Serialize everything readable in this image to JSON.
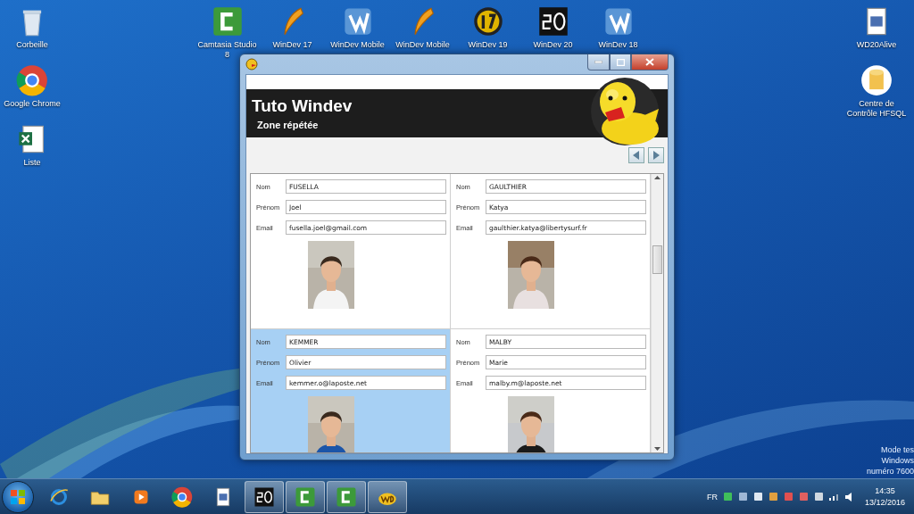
{
  "desktop": {
    "left_icons": [
      {
        "label": "Corbeille",
        "kind": "recycle-bin"
      },
      {
        "label": "Google Chrome",
        "kind": "chrome"
      },
      {
        "label": "Liste",
        "kind": "spreadsheet"
      }
    ],
    "top_icons": [
      {
        "label": "Camtasia Studio 8",
        "kind": "camtasia"
      },
      {
        "label": "WinDev 17",
        "kind": "windev"
      },
      {
        "label": "WinDev Mobile",
        "kind": "windev-mobile"
      },
      {
        "label": "WinDev Mobile",
        "kind": "windev"
      },
      {
        "label": "WinDev 19",
        "kind": "badge-19"
      },
      {
        "label": "WinDev 20",
        "kind": "badge-20"
      },
      {
        "label": "WinDev 18",
        "kind": "windev-mobile"
      }
    ],
    "right_icons": [
      {
        "label": "WD20Alive",
        "kind": "document"
      },
      {
        "label": "Centre de Contrôle HFSQL",
        "kind": "database"
      }
    ],
    "test_mode_lines": [
      "Mode tes",
      "Windows",
      "numéro 7600"
    ]
  },
  "window": {
    "header": {
      "title": "Tuto Windev",
      "subtitle": "Zone répétée"
    },
    "records": [
      {
        "selected": false,
        "fields": [
          {
            "label": "Nom",
            "value": "FUSELLA"
          },
          {
            "label": "Prénom",
            "value": "Joel"
          },
          {
            "label": "Email",
            "value": "fusella.joel@gmail.com"
          }
        ]
      },
      {
        "selected": false,
        "fields": [
          {
            "label": "Nom",
            "value": "GAULTHIER"
          },
          {
            "label": "Prénom",
            "value": "Katya"
          },
          {
            "label": "Email",
            "value": "gaulthier.katya@libertysurf.fr"
          }
        ]
      },
      {
        "selected": true,
        "fields": [
          {
            "label": "Nom",
            "value": "KEMMER"
          },
          {
            "label": "Prénom",
            "value": "Olivier"
          },
          {
            "label": "Email",
            "value": "kemmer.o@laposte.net"
          }
        ]
      },
      {
        "selected": false,
        "fields": [
          {
            "label": "Nom",
            "value": "MALBY"
          },
          {
            "label": "Prénom",
            "value": "Marie"
          },
          {
            "label": "Email",
            "value": "malby.m@laposte.net"
          }
        ]
      }
    ]
  },
  "taskbar": {
    "items": [
      {
        "kind": "ie",
        "running": false
      },
      {
        "kind": "folder",
        "running": false
      },
      {
        "kind": "media",
        "running": false
      },
      {
        "kind": "chrome",
        "running": false
      },
      {
        "kind": "document",
        "running": false
      },
      {
        "kind": "badge-20",
        "running": true
      },
      {
        "kind": "camtasia",
        "running": true
      },
      {
        "kind": "camtasia",
        "running": true
      },
      {
        "kind": "wd",
        "running": true
      }
    ],
    "language": "FR",
    "time": "14:35",
    "date": "13/12/2016"
  }
}
